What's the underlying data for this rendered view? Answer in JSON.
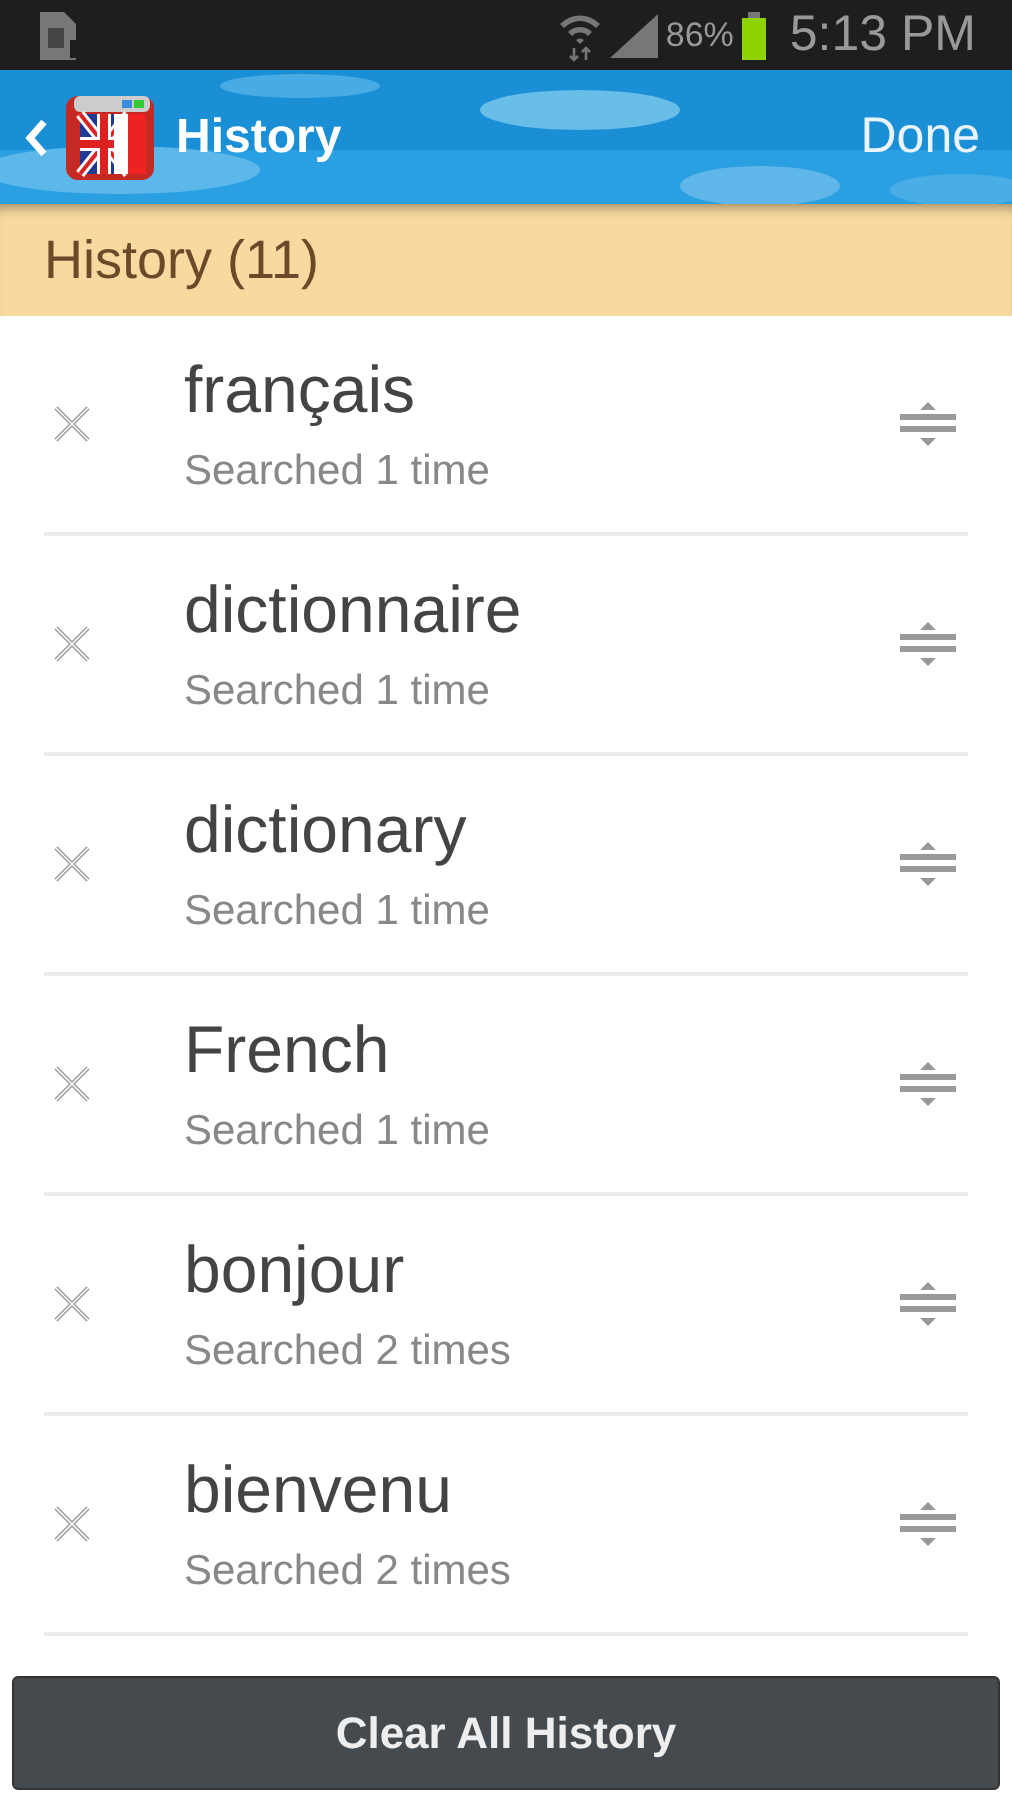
{
  "status_bar": {
    "battery": "86%",
    "time": "5:13 PM"
  },
  "app_bar": {
    "title": "History",
    "action": "Done"
  },
  "section": {
    "title": "History (11)"
  },
  "items": [
    {
      "word": "français",
      "count": "Searched 1 time"
    },
    {
      "word": "dictionnaire",
      "count": "Searched 1 time"
    },
    {
      "word": "dictionary",
      "count": "Searched 1 time"
    },
    {
      "word": "French",
      "count": "Searched 1 time"
    },
    {
      "word": "bonjour",
      "count": "Searched 2 times"
    },
    {
      "word": "bienvenu",
      "count": "Searched 2 times"
    }
  ],
  "clear_button": "Clear All History"
}
